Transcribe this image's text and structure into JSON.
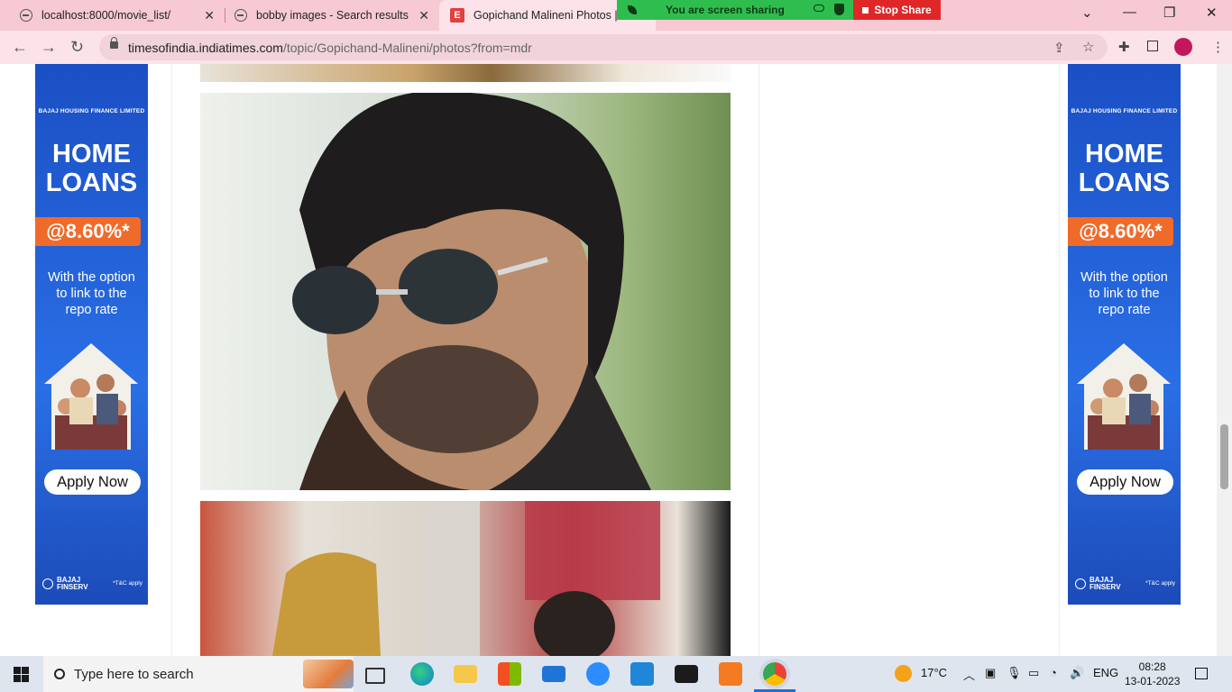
{
  "tabs": [
    {
      "title": "localhost:8000/movie_list/"
    },
    {
      "title": "bobby images - Search results"
    },
    {
      "title": "Gopichand Malineni Photos | G"
    }
  ],
  "screen_share": {
    "message": "You are screen sharing",
    "stop_label": "Stop Share"
  },
  "address": {
    "host": "timesofindia.indiatimes.com",
    "path": "/topic/Gopichand-Malineni/photos?from=mdr"
  },
  "ad": {
    "company": "BAJAJ HOUSING FINANCE LIMITED",
    "headline_line1": "HOME",
    "headline_line2": "LOANS",
    "rate": "@8.60%*",
    "sub_line1": "With the option",
    "sub_line2": "to link to the",
    "sub_line3": "repo rate",
    "cta": "Apply Now",
    "brand_line1": "BAJAJ",
    "brand_line2": "FINSERV",
    "tnc": "*T&C apply"
  },
  "taskbar": {
    "search_placeholder": "Type here to search",
    "weather": "17°C",
    "language": "ENG",
    "time": "08:28",
    "date": "13-01-2023"
  },
  "colors": {
    "tab_bar": "#f6c9d3",
    "share_green": "#2fbd4f",
    "stop_red": "#e02727",
    "ad_blue": "#2a6fe6",
    "ad_orange": "#f06a2a"
  }
}
